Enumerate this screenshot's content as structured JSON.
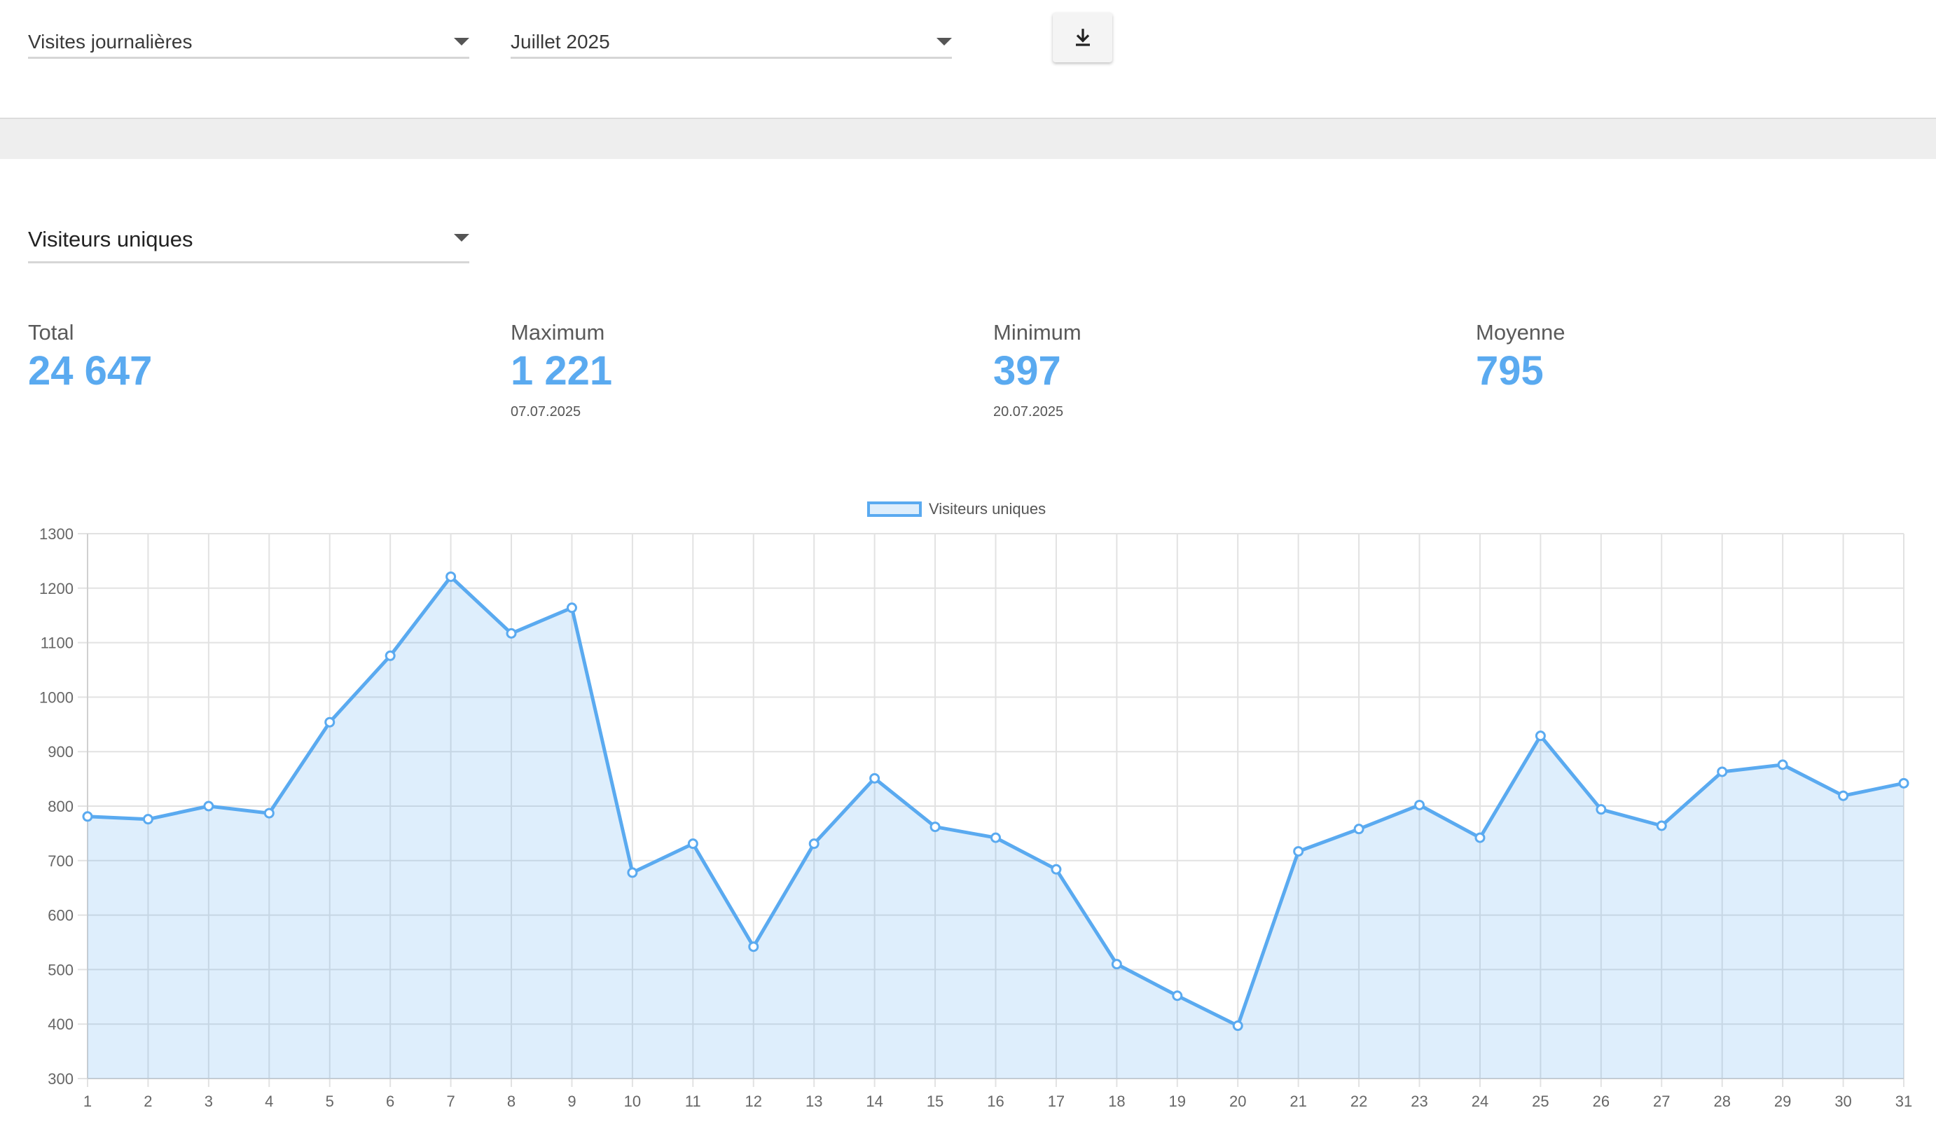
{
  "filters": {
    "report": "Visites journalières",
    "month": "Juillet 2025",
    "metric": "Visiteurs uniques"
  },
  "stats": {
    "total": {
      "label": "Total",
      "value": "24 647"
    },
    "maximum": {
      "label": "Maximum",
      "value": "1 221",
      "date": "07.07.2025"
    },
    "minimum": {
      "label": "Minimum",
      "value": "397",
      "date": "20.07.2025"
    },
    "average": {
      "label": "Moyenne",
      "value": "795"
    }
  },
  "colors": {
    "accent": "#5aaaf0",
    "fill": "rgba(90,170,240,0.2)",
    "grid": "#e0e0e0"
  },
  "icons": {
    "download": "download-icon",
    "dropdown": "caret-down-icon"
  },
  "chart_data": {
    "type": "area",
    "legend_position": "top",
    "grid": true,
    "categories": [
      "1",
      "2",
      "3",
      "4",
      "5",
      "6",
      "7",
      "8",
      "9",
      "10",
      "11",
      "12",
      "13",
      "14",
      "15",
      "16",
      "17",
      "18",
      "19",
      "20",
      "21",
      "22",
      "23",
      "24",
      "25",
      "26",
      "27",
      "28",
      "29",
      "30",
      "31"
    ],
    "series": [
      {
        "name": "Visiteurs uniques",
        "values": [
          781,
          776,
          800,
          787,
          954,
          1076,
          1221,
          1117,
          1164,
          678,
          731,
          542,
          731,
          851,
          762,
          742,
          684,
          510,
          452,
          397,
          717,
          758,
          802,
          742,
          929,
          794,
          764,
          863,
          876,
          819,
          842
        ]
      }
    ],
    "ylim": [
      300,
      1300
    ],
    "yticks": [
      300,
      400,
      500,
      600,
      700,
      800,
      900,
      1000,
      1100,
      1200,
      1300
    ]
  }
}
